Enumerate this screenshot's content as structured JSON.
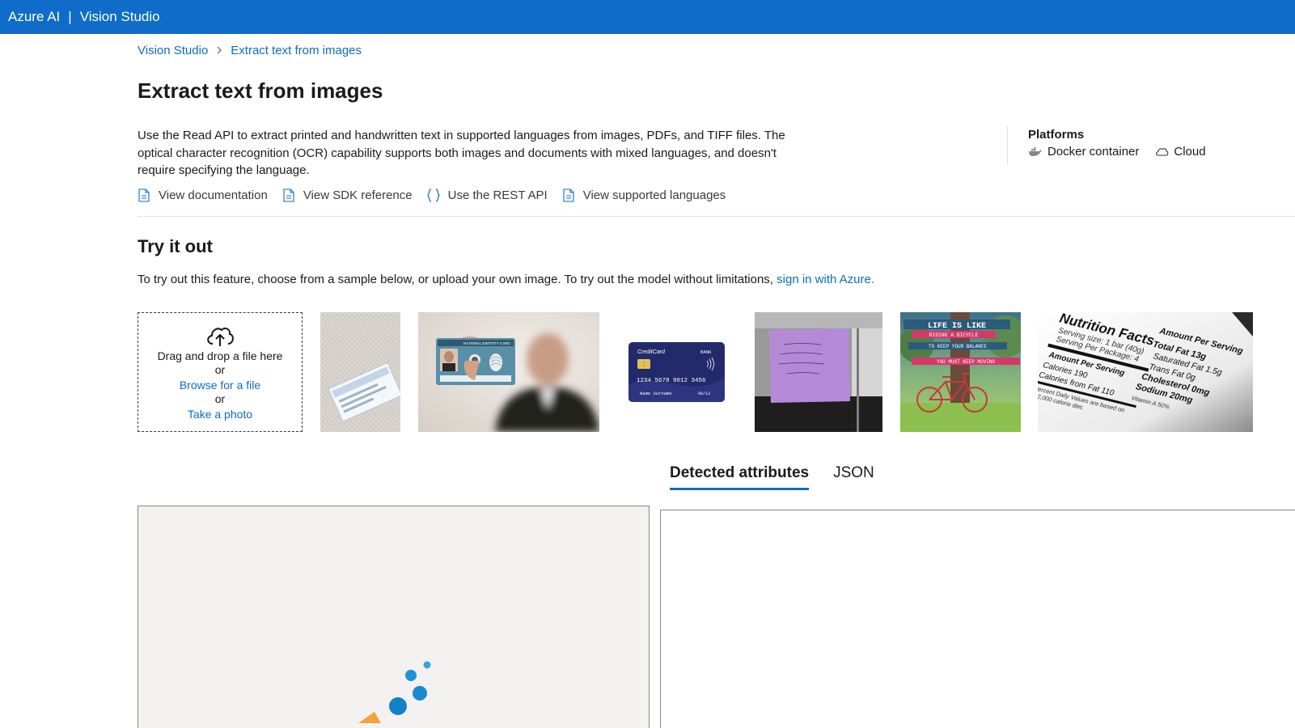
{
  "header": {
    "brand": "Azure AI",
    "separator": "|",
    "product": "Vision Studio"
  },
  "breadcrumb": {
    "root": "Vision Studio",
    "current": "Extract text from images"
  },
  "page": {
    "title": "Extract text from images",
    "description": "Use the Read API to extract printed and handwritten text in supported languages from images, PDFs, and TIFF files. The optical character recognition (OCR) capability supports both images and documents with mixed languages, and doesn't require specifying the language."
  },
  "links": [
    {
      "label": "View documentation",
      "icon": "document-icon"
    },
    {
      "label": "View SDK reference",
      "icon": "document-icon"
    },
    {
      "label": "Use the REST API",
      "icon": "braces-icon"
    },
    {
      "label": "View supported languages",
      "icon": "document-icon"
    }
  ],
  "platforms": {
    "title": "Platforms",
    "docker": "Docker container",
    "cloud": "Cloud"
  },
  "try": {
    "title": "Try it out",
    "intro": "To try out this feature, choose from a sample below, or upload your own image. To try out the model without limitations,",
    "signin": "sign in with Azure."
  },
  "upload": {
    "drag": "Drag and drop a file here",
    "or1": "or",
    "browse": "Browse for a file",
    "or2": "or",
    "photo": "Take a photo"
  },
  "samples": {
    "credit_card": {
      "brand": "CreditCard",
      "bank": "BANK",
      "number": "1234 5678 9012 3456",
      "name": "Name Surname",
      "expiry": "08/13"
    },
    "id_card": {
      "header": "NATIONAL IDENTITY CARD"
    },
    "poster": {
      "line1": "LIFE IS LIKE",
      "line2": "RIDING A BICYCLE",
      "line3": "TO KEEP YOUR BALANCE",
      "line4": "YOU MUST KEEP MOVING"
    },
    "nutrition": {
      "title": "Nutrition Facts",
      "serving1": "Serving size: 1 bar (40g)",
      "serving2": "Serving Per Package: 4",
      "amount1": "Amount Per Serving",
      "calories": "Calories 190",
      "fat_cal": "Calories from Fat 110",
      "daily1": "Percent Daily Values are based on",
      "daily2": "a 2,000 calorie diet.",
      "amount2": "Amount Per Serving",
      "total_fat": "Total Fat 13g",
      "sat_fat": "Saturated Fat 1.5g",
      "trans_fat": "Trans Fat 0g",
      "cholesterol": "Cholesterol 0mg",
      "sodium": "Sodium 20mg",
      "vitamin": "Vitamin A 50%"
    }
  },
  "tabs": {
    "detected": "Detected attributes",
    "json": "JSON"
  },
  "colors": {
    "header": "#0f6cc9",
    "link": "#0f6cbd"
  }
}
